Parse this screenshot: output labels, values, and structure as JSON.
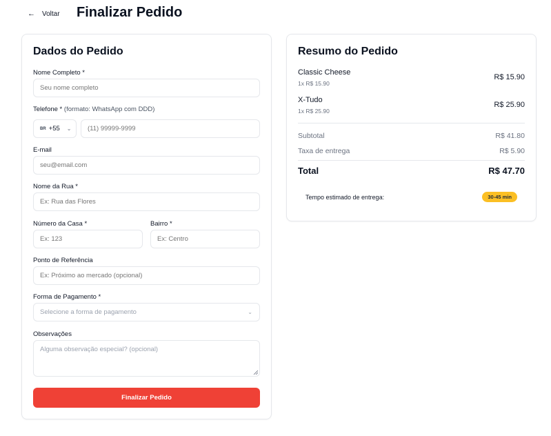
{
  "header": {
    "back_label": "Voltar",
    "title": "Finalizar Pedido"
  },
  "form": {
    "title": "Dados do Pedido",
    "name": {
      "label": "Nome Completo *",
      "placeholder": "Seu nome completo"
    },
    "phone": {
      "label": "Telefone *",
      "hint": "(formato: WhatsApp com DDD)",
      "country_flag": "BR",
      "country_code": "+55",
      "placeholder": "(11) 99999-9999"
    },
    "email": {
      "label": "E-mail",
      "placeholder": "seu@email.com"
    },
    "street": {
      "label": "Nome da Rua *",
      "placeholder": "Ex: Rua das Flores"
    },
    "number": {
      "label": "Número da Casa *",
      "placeholder": "Ex: 123"
    },
    "district": {
      "label": "Bairro *",
      "placeholder": "Ex: Centro"
    },
    "reference": {
      "label": "Ponto de Referência",
      "placeholder": "Ex: Próximo ao mercado (opcional)"
    },
    "payment": {
      "label": "Forma de Pagamento *",
      "selected": "Selecione a forma de pagamento"
    },
    "notes": {
      "label": "Observações",
      "placeholder": "Alguma observação especial? (opcional)"
    },
    "submit_label": "Finalizar Pedido"
  },
  "summary": {
    "title": "Resumo do Pedido",
    "items": [
      {
        "name": "Classic Cheese",
        "detail": "1x R$ 15.90",
        "price": "R$ 15.90"
      },
      {
        "name": "X-Tudo",
        "detail": "1x R$ 25.90",
        "price": "R$ 25.90"
      }
    ],
    "subtotal_label": "Subtotal",
    "subtotal_value": "R$ 41.80",
    "delivery_label": "Taxa de entrega",
    "delivery_value": "R$ 5.90",
    "total_label": "Total",
    "total_value": "R$ 47.70",
    "eta_label": "Tempo estimado de entrega:",
    "eta_value": "30-45 min"
  },
  "colors": {
    "accent": "#ef4136",
    "badge": "#fbbf24"
  }
}
